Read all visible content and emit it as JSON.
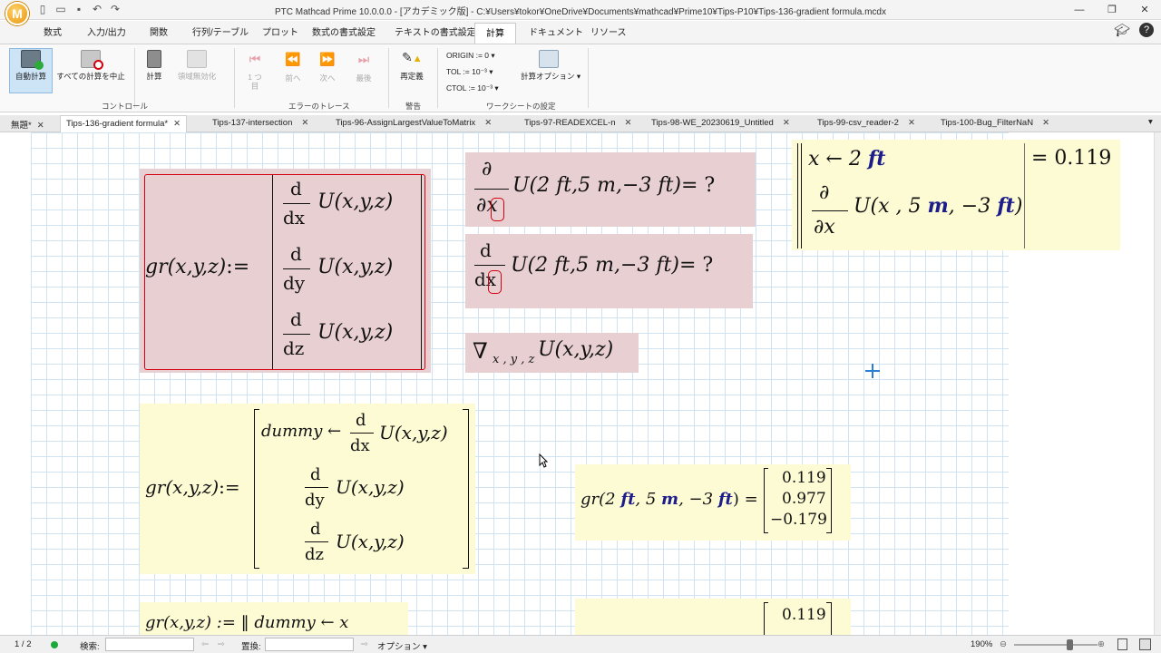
{
  "titlebar": {
    "title": "PTC Mathcad Prime 10.0.0.0 - [アカデミック版] - C:¥Users¥tokor¥OneDrive¥Documents¥mathcad¥Prime10¥Tips-P10¥Tips-136-gradient formula.mcdx",
    "logo": "M"
  },
  "ribbon_tabs": [
    "数式",
    "入力/出力",
    "関数",
    "行列/テーブル",
    "プロット",
    "数式の書式設定",
    "テキストの書式設定",
    "計算",
    "ドキュメント",
    "リソース"
  ],
  "ribbon": {
    "auto_calc": "自動計算",
    "stop_all": "すべての計算を中止",
    "calc": "計算",
    "disable_area": "領域無効化",
    "group_control": "コントロール",
    "first": "1 つ目",
    "prev": "前へ",
    "next": "次へ",
    "last": "最後",
    "group_error": "エラーのトレース",
    "redefine": "再定義",
    "group_warning": "警告",
    "origin": "ORIGIN := 0",
    "tol": "TOL := 10⁻³",
    "ctol": "CTOL := 10⁻³",
    "calc_options": "計算オプション",
    "group_worksheet": "ワークシートの設定"
  },
  "doc_tabs": [
    "無題*",
    "Tips-136-gradient formula*",
    "Tips-137-intersection",
    "Tips-96-AssignLargestValueToMatrix",
    "Tips-97-READEXCEL-n",
    "Tips-98-WE_20230619_Untitled",
    "Tips-99-csv_reader-2",
    "Tips-100-Bug_FilterNaN"
  ],
  "math": {
    "gr": "gr",
    "args": "(x,y,z)",
    "define": ":=",
    "d": "d",
    "dx": "dx",
    "dy": "dy",
    "dz": "dz",
    "U": "U",
    "partial": "∂",
    "partial_x": "∂x",
    "eval_unknown": "= ?",
    "point": "(2 ft,5 m,−3 ft)",
    "nabla": "∇",
    "nabla_sub": "x , y , z",
    "dummy": "dummy ←",
    "x_assign": "x ← 2",
    "ft": "ft",
    "m_unit": "m",
    "partial_args": "(x , 5",
    "neg3": ", −3",
    "result_scalar": "= 0.119",
    "gr_point_a": "gr(2",
    "gr_point_b": ", 5",
    "gr_point_c": ", −3",
    "gr_point_d": ") =",
    "result_vector": [
      "0.119",
      "0.977",
      "−0.179"
    ],
    "partial_line": "gr(x,y,z) := ‖ dummy ← x",
    "partial_vector_top": "0.119"
  },
  "status": {
    "page": "1 / 2",
    "search_label": "検索:",
    "replace_label": "置換:",
    "options": "オプション",
    "zoom": "190%"
  }
}
